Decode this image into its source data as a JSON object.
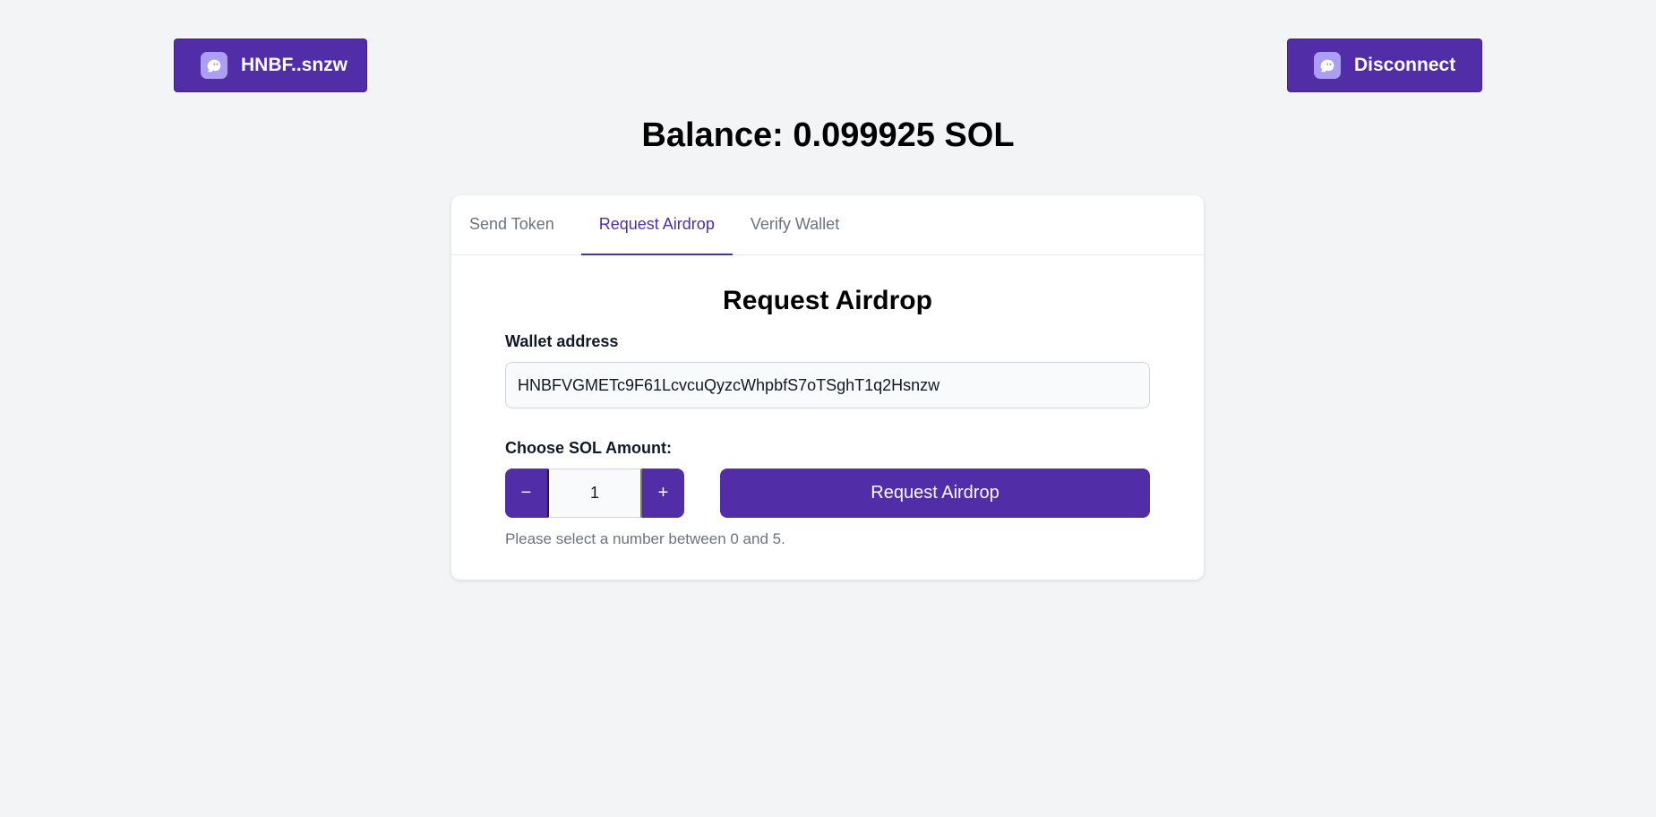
{
  "header": {
    "wallet_button_label": "HNBF..snzw",
    "disconnect_button_label": "Disconnect",
    "wallet_icon": "phantom-ghost-icon"
  },
  "balance": {
    "text": "Balance: 0.099925 SOL"
  },
  "tabs": [
    {
      "label": "Send Token",
      "active": false
    },
    {
      "label": "Request Airdrop",
      "active": true
    },
    {
      "label": "Verify Wallet",
      "active": false
    }
  ],
  "form": {
    "title": "Request Airdrop",
    "wallet_label": "Wallet address",
    "wallet_value": "HNBFVGMETc9F61LcvcuQyzcWhpbfS7oTSghT1q2Hsnzw",
    "amount_label": "Choose SOL Amount:",
    "decrement_symbol": "−",
    "increment_symbol": "+",
    "amount_value": "1",
    "submit_label": "Request Airdrop",
    "hint": "Please select a number between 0 and 5."
  },
  "colors": {
    "accent": "#512da8",
    "icon_bg": "#ab9ff2",
    "background": "#f3f4f6"
  }
}
